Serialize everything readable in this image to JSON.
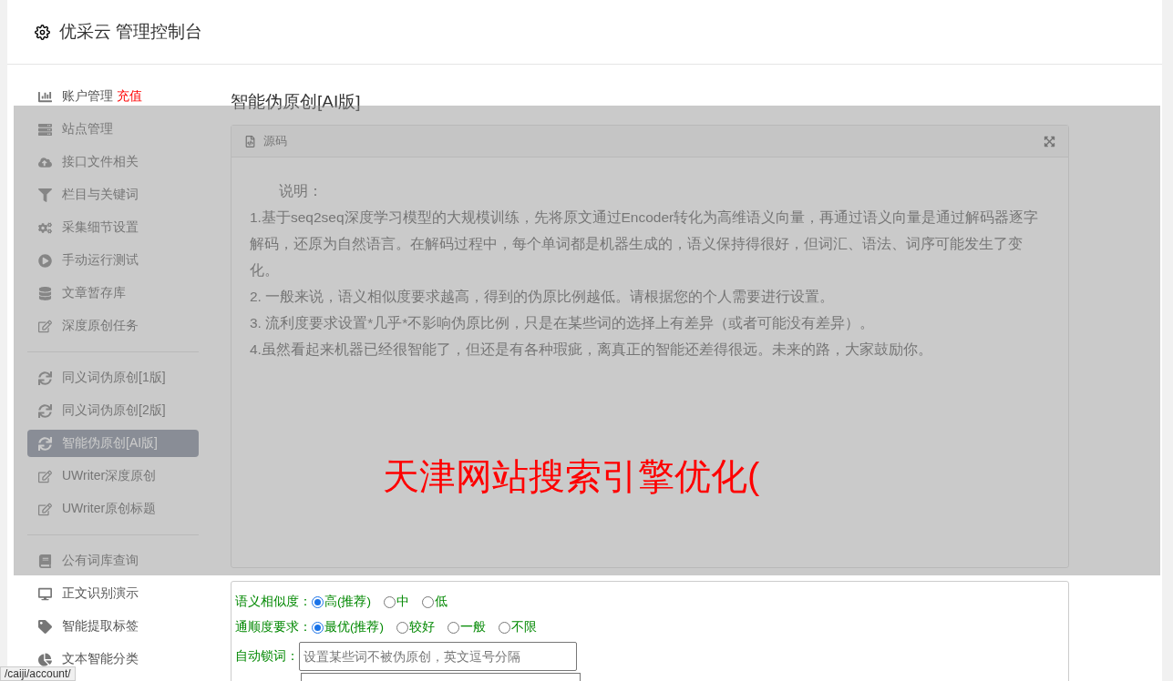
{
  "header": {
    "title": "优采云 管理控制台"
  },
  "sidebar": {
    "sections": [
      [
        {
          "label": "账户管理",
          "badge": "充值",
          "selected": false
        },
        {
          "label": "站点管理",
          "selected": false
        },
        {
          "label": "接口文件相关",
          "selected": false
        },
        {
          "label": "栏目与关键词",
          "selected": false
        },
        {
          "label": "采集细节设置",
          "selected": false
        },
        {
          "label": "手动运行测试",
          "selected": false
        },
        {
          "label": "文章暂存库",
          "selected": false
        },
        {
          "label": "深度原创任务",
          "selected": false
        }
      ],
      [
        {
          "label": "同义词伪原创[1版]",
          "selected": false
        },
        {
          "label": "同义词伪原创[2版]",
          "selected": false
        },
        {
          "label": "智能伪原创[AI版]",
          "selected": true
        },
        {
          "label": "UWriter深度原创",
          "selected": false
        },
        {
          "label": "UWriter原创标题",
          "selected": false
        }
      ],
      [
        {
          "label": "公有词库查询",
          "selected": false
        },
        {
          "label": "正文识别演示",
          "selected": false
        },
        {
          "label": "智能提取标签",
          "selected": false
        },
        {
          "label": "文本智能分类",
          "selected": false
        }
      ]
    ]
  },
  "page_title": "智能伪原创[AI版]",
  "editor": {
    "tab": "源码",
    "heading": "说明：",
    "paragraphs": [
      "1.基于seq2seq深度学习模型的大规模训练，先将原文通过Encoder转化为高维语义向量，再通过语义向量是通过解码器逐字解码，还原为自然语言。在解码过程中，每个单词都是机器生成的，语义保持得很好，但词汇、语法、词序可能发生了变化。",
      "2. 一般来说，语义相似度要求越高，得到的伪原比例越低。请根据您的个人需要进行设置。",
      "3. 流利度要求设置*几乎*不影响伪原比例，只是在某些词的选择上有差异（或者可能没有差异）。",
      "4.虽然看起来机器已经很智能了，但还是有各种瑕疵，离真正的智能还差得很远。未来的路，大家鼓励你。"
    ]
  },
  "overlay_text": "天津网站搜索引擎优化(",
  "form": {
    "radio_groups": [
      {
        "label": "语义相似度：",
        "options": [
          {
            "label": "高(推荐)",
            "selected": true
          },
          {
            "label": "中",
            "selected": false
          },
          {
            "label": "低",
            "selected": false
          }
        ]
      },
      {
        "label": "通顺度要求：",
        "options": [
          {
            "label": "最优(推荐)",
            "selected": true
          },
          {
            "label": "较好",
            "selected": false
          },
          {
            "label": "一般",
            "selected": false
          },
          {
            "label": "不限",
            "selected": false
          }
        ]
      }
    ],
    "lock_words": {
      "label": "自动锁词：",
      "placeholder": "设置某些词不被伪原创，英文逗号分隔"
    }
  },
  "status_url": "/caiji/account/"
}
